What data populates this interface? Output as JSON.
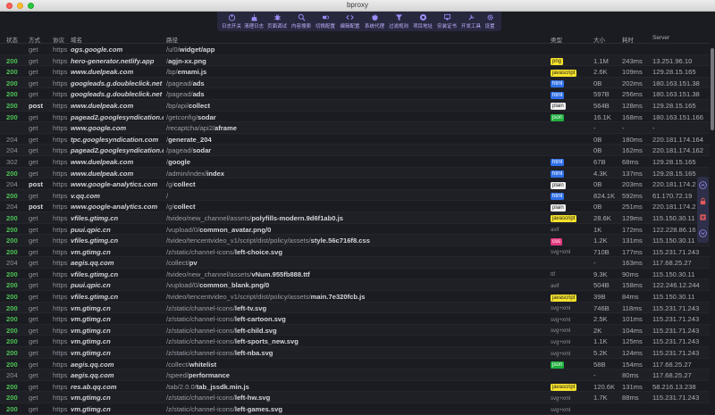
{
  "window": {
    "title": "bproxy"
  },
  "toolbar": {
    "items": [
      {
        "label": "日志开关",
        "icon": "power-icon"
      },
      {
        "label": "清理日志",
        "icon": "broom-icon"
      },
      {
        "label": "页面调试",
        "icon": "bug-icon"
      },
      {
        "label": "内容搜索",
        "icon": "search-icon"
      },
      {
        "label": "切换配置",
        "icon": "switch-icon"
      },
      {
        "label": "编辑配置",
        "icon": "code-icon"
      },
      {
        "label": "系统代理",
        "icon": "apple-icon"
      },
      {
        "label": "过滤规则",
        "icon": "filter-icon"
      },
      {
        "label": "项目地址",
        "icon": "github-icon"
      },
      {
        "label": "安装证书",
        "icon": "certificate-icon"
      },
      {
        "label": "开发工具",
        "icon": "tools-icon"
      },
      {
        "label": "设置",
        "icon": "gear-icon"
      }
    ],
    "label_color": "#bfaefc"
  },
  "table": {
    "headers": {
      "status": "状态",
      "method": "方式",
      "protocol": "协议",
      "host": "域名",
      "path": "路径",
      "type": "类型",
      "size": "大小",
      "time": "耗时",
      "server": "Server"
    },
    "rows": [
      {
        "status": "",
        "method": "get",
        "protocol": "https",
        "host": "ogs.google.com",
        "path_pre": "/u/0/",
        "path_bold": "widget/app",
        "type": "",
        "size": "",
        "time": "",
        "server": ""
      },
      {
        "status": "200",
        "method": "get",
        "protocol": "https",
        "host": "hero-generator.netlify.app",
        "path_pre": "/",
        "path_bold": "agjn-xx.png",
        "type": "png",
        "size": "1.1M",
        "time": "243ms",
        "server": "13.251.96.10"
      },
      {
        "status": "200",
        "method": "get",
        "protocol": "https",
        "host": "www.duelpeak.com",
        "path_pre": "/bp/",
        "path_bold": "emami.js",
        "type": "javascript",
        "size": "2.6K",
        "time": "109ms",
        "server": "129.28.15.165"
      },
      {
        "status": "200",
        "method": "get",
        "protocol": "https",
        "host": "googleads.g.doubleclick.net",
        "path_pre": "/pagead/",
        "path_bold": "ads",
        "type": "html",
        "size": "0B",
        "time": "202ms",
        "server": "180.163.151.38"
      },
      {
        "status": "200",
        "method": "get",
        "protocol": "https",
        "host": "googleads.g.doubleclick.net",
        "path_pre": "/pagead/",
        "path_bold": "ads",
        "type": "html",
        "size": "597B",
        "time": "256ms",
        "server": "180.163.151.38"
      },
      {
        "status": "200",
        "method": "post",
        "protocol": "https",
        "host": "www.duelpeak.com",
        "path_pre": "/bp/api/",
        "path_bold": "collect",
        "type": "plain",
        "size": "564B",
        "time": "128ms",
        "server": "129.28.15.165"
      },
      {
        "status": "200",
        "method": "get",
        "protocol": "https",
        "host": "pagead2.googlesyndication.c...",
        "path_pre": "/getconfig/",
        "path_bold": "sodar",
        "type": "json",
        "size": "16.1K",
        "time": "168ms",
        "server": "180.163.151.166"
      },
      {
        "status": "",
        "method": "get",
        "protocol": "https",
        "host": "www.google.com",
        "path_pre": "/recaptcha/api2/",
        "path_bold": "aframe",
        "type": "",
        "size": "-",
        "time": "-",
        "server": "-"
      },
      {
        "status": "204",
        "method": "get",
        "protocol": "https",
        "host": "tpc.googlesyndication.com",
        "path_pre": "/",
        "path_bold": "generate_204",
        "type": "",
        "size": "0B",
        "time": "180ms",
        "server": "220.181.174.164"
      },
      {
        "status": "204",
        "method": "get",
        "protocol": "https",
        "host": "pagead2.googlesyndication.c...",
        "path_pre": "/pagead/",
        "path_bold": "sodar",
        "type": "",
        "size": "0B",
        "time": "162ms",
        "server": "220.181.174.162"
      },
      {
        "status": "302",
        "method": "get",
        "protocol": "https",
        "host": "www.duelpeak.com",
        "path_pre": "/",
        "path_bold": "google",
        "type": "html",
        "size": "67B",
        "time": "68ms",
        "server": "129.28.15.165"
      },
      {
        "status": "200",
        "method": "get",
        "protocol": "https",
        "host": "www.duelpeak.com",
        "path_pre": "/admin/index/",
        "path_bold": "index",
        "type": "html",
        "size": "4.3K",
        "time": "137ms",
        "server": "129.28.15.165"
      },
      {
        "status": "204",
        "method": "post",
        "protocol": "https",
        "host": "www.google-analytics.com",
        "path_pre": "/g/",
        "path_bold": "collect",
        "type": "plain",
        "size": "0B",
        "time": "203ms",
        "server": "220.181.174.2"
      },
      {
        "status": "200",
        "method": "get",
        "protocol": "https",
        "host": "v.qq.com",
        "path_pre": "/",
        "path_bold": "",
        "type": "html",
        "size": "824.1K",
        "time": "592ms",
        "server": "61.170.72.19"
      },
      {
        "status": "204",
        "method": "post",
        "protocol": "https",
        "host": "www.google-analytics.com",
        "path_pre": "/g/",
        "path_bold": "collect",
        "type": "plain",
        "size": "0B",
        "time": "251ms",
        "server": "220.181.174.2"
      },
      {
        "status": "200",
        "method": "get",
        "protocol": "https",
        "host": "vfiles.gtimg.cn",
        "path_pre": "/tvideo/new_channel/assets/",
        "path_bold": "polyfills-modern.9d6f1ab0.js",
        "type": "javascript",
        "size": "28.6K",
        "time": "129ms",
        "server": "115.150.30.11"
      },
      {
        "status": "200",
        "method": "get",
        "protocol": "https",
        "host": "puui.qpic.cn",
        "path_pre": "/vupload/0/",
        "path_bold": "common_avatar.png/0",
        "type": "avif",
        "size": "1K",
        "time": "172ms",
        "server": "122.228.86.16"
      },
      {
        "status": "200",
        "method": "get",
        "protocol": "https",
        "host": "vfiles.gtimg.cn",
        "path_pre": "/tvideo/tencentvideo_v1/script/dist/policy/assets/",
        "path_bold": "style.56c716f8.css",
        "type": "css",
        "size": "1.2K",
        "time": "131ms",
        "server": "115.150.30.11"
      },
      {
        "status": "200",
        "method": "get",
        "protocol": "https",
        "host": "vm.gtimg.cn",
        "path_pre": "/z/static/channel-icons/",
        "path_bold": "left-choice.svg",
        "type": "svg+xml",
        "size": "710B",
        "time": "177ms",
        "server": "115.231.71.243"
      },
      {
        "status": "204",
        "method": "get",
        "protocol": "https",
        "host": "aegis.qq.com",
        "path_pre": "/collect/",
        "path_bold": "pv",
        "type": "",
        "size": "-",
        "time": "163ms",
        "server": "117.68.25.27"
      },
      {
        "status": "200",
        "method": "get",
        "protocol": "https",
        "host": "vfiles.gtimg.cn",
        "path_pre": "/tvideo/new_channel/assets/",
        "path_bold": "vNum.955fb888.ttf",
        "type": "ttf",
        "size": "9.3K",
        "time": "90ms",
        "server": "115.150.30.11"
      },
      {
        "status": "200",
        "method": "get",
        "protocol": "https",
        "host": "puui.qpic.cn",
        "path_pre": "/vupload/0/",
        "path_bold": "common_blank.png/0",
        "type": "avif",
        "size": "504B",
        "time": "158ms",
        "server": "122.246.12.244"
      },
      {
        "status": "200",
        "method": "get",
        "protocol": "https",
        "host": "vfiles.gtimg.cn",
        "path_pre": "/tvideo/tencentvideo_v1/script/dist/policy/assets/",
        "path_bold": "main.7e320fcb.js",
        "type": "javascript",
        "size": "39B",
        "time": "84ms",
        "server": "115.150.30.11"
      },
      {
        "status": "200",
        "method": "get",
        "protocol": "https",
        "host": "vm.gtimg.cn",
        "path_pre": "/z/static/channel-icons/",
        "path_bold": "left-tv.svg",
        "type": "svg+xml",
        "size": "746B",
        "time": "118ms",
        "server": "115.231.71.243"
      },
      {
        "status": "200",
        "method": "get",
        "protocol": "https",
        "host": "vm.gtimg.cn",
        "path_pre": "/z/static/channel-icons/",
        "path_bold": "left-cartoon.svg",
        "type": "svg+xml",
        "size": "2.5K",
        "time": "101ms",
        "server": "115.231.71.243"
      },
      {
        "status": "200",
        "method": "get",
        "protocol": "https",
        "host": "vm.gtimg.cn",
        "path_pre": "/z/static/channel-icons/",
        "path_bold": "left-child.svg",
        "type": "svg+xml",
        "size": "2K",
        "time": "104ms",
        "server": "115.231.71.243"
      },
      {
        "status": "200",
        "method": "get",
        "protocol": "https",
        "host": "vm.gtimg.cn",
        "path_pre": "/z/static/channel-icons/",
        "path_bold": "left-sports_new.svg",
        "type": "svg+xml",
        "size": "1.1K",
        "time": "125ms",
        "server": "115.231.71.243"
      },
      {
        "status": "200",
        "method": "get",
        "protocol": "https",
        "host": "vm.gtimg.cn",
        "path_pre": "/z/static/channel-icons/",
        "path_bold": "left-nba.svg",
        "type": "svg+xml",
        "size": "5.2K",
        "time": "124ms",
        "server": "115.231.71.243"
      },
      {
        "status": "200",
        "method": "get",
        "protocol": "https",
        "host": "aegis.qq.com",
        "path_pre": "/collect/",
        "path_bold": "whitelist",
        "type": "json",
        "size": "58B",
        "time": "154ms",
        "server": "117.68.25.27"
      },
      {
        "status": "204",
        "method": "get",
        "protocol": "https",
        "host": "aegis.qq.com",
        "path_pre": "/speed/",
        "path_bold": "performance",
        "type": "",
        "size": "-",
        "time": "80ms",
        "server": "117.68.25.27"
      },
      {
        "status": "200",
        "method": "get",
        "protocol": "https",
        "host": "res.ab.qq.com",
        "path_pre": "/tab/2.0.0/",
        "path_bold": "tab_jssdk.min.js",
        "type": "javascript",
        "size": "120.6K",
        "time": "131ms",
        "server": "58.216.13.238"
      },
      {
        "status": "200",
        "method": "get",
        "protocol": "https",
        "host": "vm.gtimg.cn",
        "path_pre": "/z/static/channel-icons/",
        "path_bold": "left-hw.svg",
        "type": "svg+xml",
        "size": "1.7K",
        "time": "88ms",
        "server": "115.231.71.243"
      },
      {
        "status": "200",
        "method": "get",
        "protocol": "https",
        "host": "vm.gtimg.cn",
        "path_pre": "/z/static/channel-icons/",
        "path_bold": "left-games.svg",
        "type": "svg+xml",
        "size": "",
        "time": "",
        "server": ""
      }
    ]
  },
  "side_panel": {
    "icons": [
      "chevron-up-icon",
      "lock-icon",
      "delete-icon",
      "chevron-down-icon"
    ]
  },
  "colors": {
    "status_ok": "#4cc356",
    "badge_yellow": "#f6e22b",
    "badge_blue": "#2f6fe8",
    "badge_green": "#1fae3d",
    "badge_pink": "#e0397e",
    "toolbar_bg": "#27283e",
    "background": "#1b1c21"
  }
}
